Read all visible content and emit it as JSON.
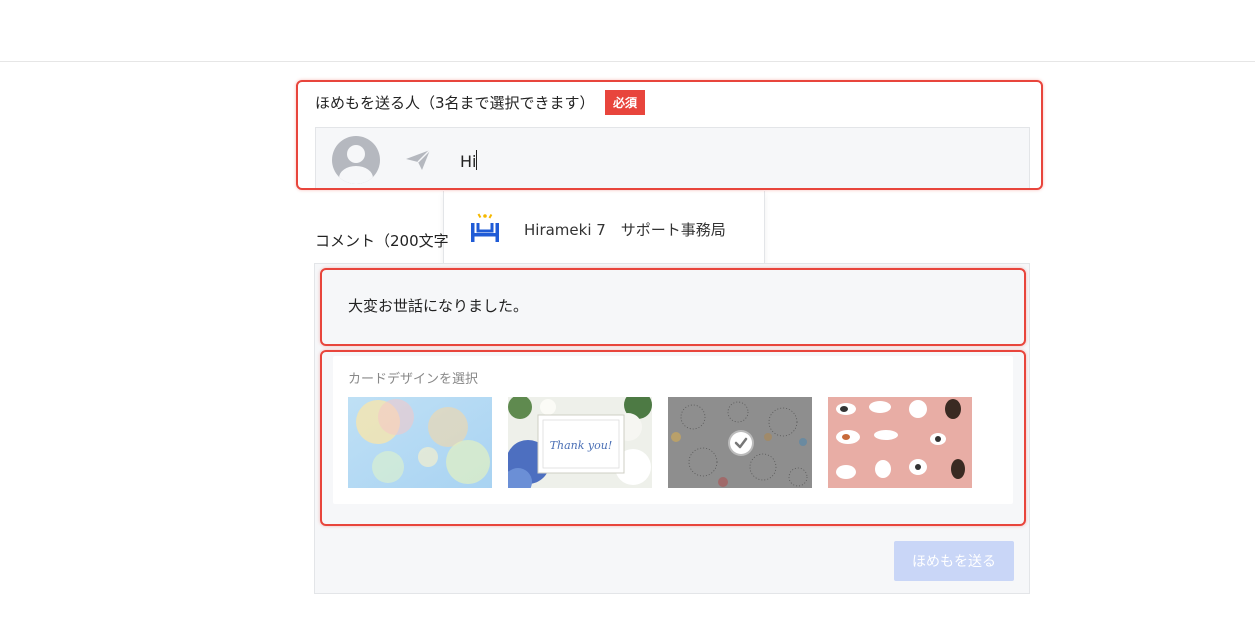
{
  "recipient": {
    "label": "ほめもを送る人（3名まで選択できます）",
    "required_badge": "必須",
    "input_value": "Hi",
    "avatar_icon": "user-avatar-icon",
    "send_icon": "paper-plane-icon"
  },
  "suggestion": {
    "name": "Hirameki 7　サポート事務局",
    "logo_icon": "hirameki-logo-icon"
  },
  "comment": {
    "label": "コメント（200文字",
    "text": "大変お世話になりました。"
  },
  "card_design": {
    "label": "カードデザインを選択",
    "cards": [
      {
        "name": "bubbles",
        "selected": false
      },
      {
        "name": "thank-you-flowers",
        "selected": false,
        "text": "Thank you!"
      },
      {
        "name": "fireworks-gray",
        "selected": true
      },
      {
        "name": "cats-pink",
        "selected": false
      }
    ]
  },
  "submit": {
    "label": "ほめもを送る"
  },
  "colors": {
    "required": "#e8453c",
    "submit_disabled": "#c9d6f7",
    "highlight": "#e8453c"
  }
}
